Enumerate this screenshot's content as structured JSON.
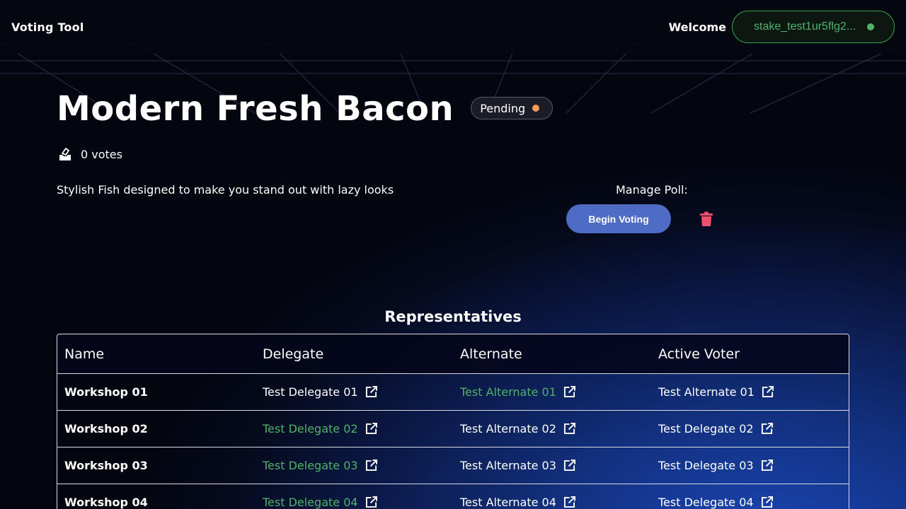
{
  "header": {
    "app_title": "Voting Tool",
    "welcome_label": "Welcome",
    "wallet_address": "stake_test1ur5flg2..."
  },
  "poll": {
    "title": "Modern Fresh Bacon",
    "status": "Pending",
    "votes_label": "0 votes",
    "description": "Stylish Fish designed to make you stand out with lazy looks"
  },
  "manage": {
    "label": "Manage Poll:",
    "begin_voting_label": "Begin Voting"
  },
  "representatives": {
    "title": "Representatives",
    "columns": [
      "Name",
      "Delegate",
      "Alternate",
      "Active Voter"
    ],
    "rows": [
      {
        "name": "Workshop 01",
        "delegate": "Test Delegate 01",
        "alternate": "Test Alternate 01",
        "active_voter": "Test Alternate 01"
      },
      {
        "name": "Workshop 02",
        "delegate": "Test Delegate 02",
        "alternate": "Test Alternate 02",
        "active_voter": "Test Delegate 02"
      },
      {
        "name": "Workshop 03",
        "delegate": "Test Delegate 03",
        "alternate": "Test Alternate 03",
        "active_voter": "Test Delegate 03"
      },
      {
        "name": "Workshop 04",
        "delegate": "Test Delegate 04",
        "alternate": "Test Alternate 04",
        "active_voter": "Test Delegate 04"
      }
    ]
  },
  "colors": {
    "accent_green": "#4fb36a",
    "status_pending": "#f59a5b",
    "primary_button": "#4f6cc4",
    "delete_red": "#f0506e"
  },
  "icons": {
    "votes": "ballot-box-icon",
    "delete": "trash-icon",
    "external_link": "external-link-icon"
  }
}
